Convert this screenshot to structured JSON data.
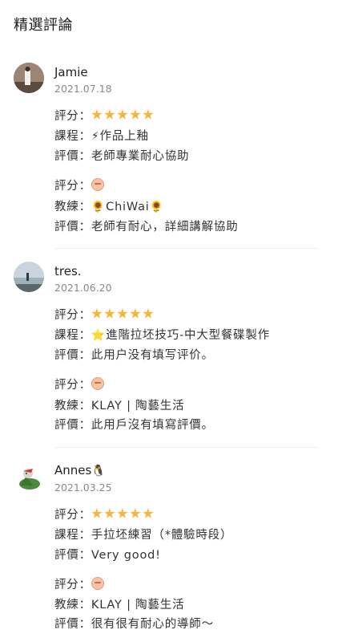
{
  "section_title": "精選評論",
  "reviews": [
    {
      "name": "Jamie",
      "date": "2021.07.18",
      "score_label": "評分：",
      "course_label": "課程：",
      "course_icon": "⚡",
      "course_name": "作品上釉",
      "eval_label": "評價：",
      "course_eval": "老師專業耐心協助",
      "score2_label": "評分：",
      "coach_label": "教練：",
      "coach_icon_left": "🌻",
      "coach_name": "ChiWai",
      "coach_icon_right": "🌻",
      "eval2_label": "評價：",
      "coach_eval": "老師有耐心，詳細講解協助",
      "rating_stars": 5
    },
    {
      "name": "tres.",
      "date": "2021.06.20",
      "score_label": "評分：",
      "course_label": "課程：",
      "course_icon": "⭐",
      "course_name": "進階拉坯技巧-中大型餐碟製作",
      "eval_label": "評價：",
      "course_eval": "此用户没有填写评价。",
      "score2_label": "評分：",
      "coach_label": "教練：",
      "coach_name": "KLAY | 陶藝生活",
      "eval2_label": "評價：",
      "coach_eval": "此用戶沒有填寫評價。",
      "rating_stars": 5
    },
    {
      "name": "Annes",
      "name_icon": "🐧",
      "date": "2021.03.25",
      "score_label": "評分：",
      "course_label": "課程：",
      "course_name": "手拉坯練習（*體驗時段）",
      "eval_label": "評價：",
      "course_eval": "Very good!",
      "score2_label": "評分：",
      "coach_label": "教練：",
      "coach_name": "KLAY | 陶藝生活",
      "eval2_label": "評價：",
      "coach_eval": "很有很有耐心的導師～",
      "rating_stars": 5
    }
  ],
  "colors": {
    "star": "#f5b63a",
    "date": "#8a8a8a",
    "text": "#333333"
  }
}
